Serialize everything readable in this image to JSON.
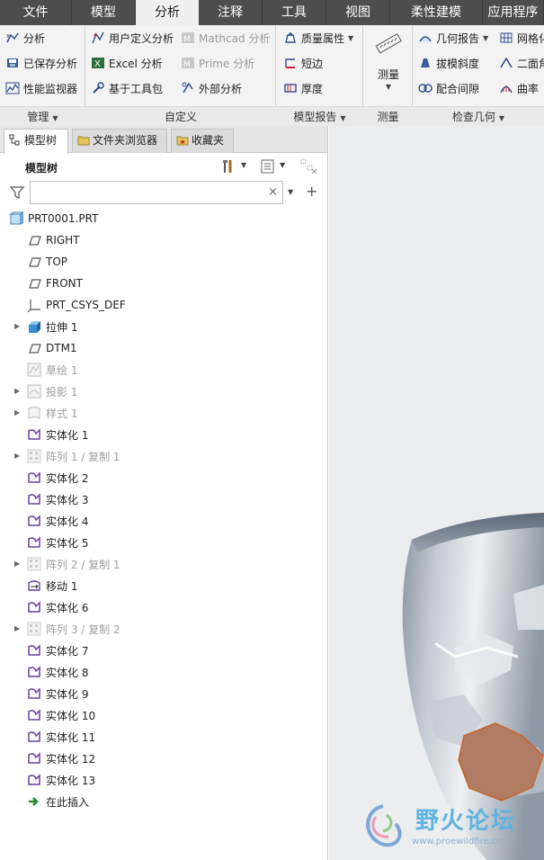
{
  "menu": {
    "tabs": [
      {
        "label": "文件"
      },
      {
        "label": "模型"
      },
      {
        "label": "分析"
      },
      {
        "label": "注释"
      },
      {
        "label": "工具"
      },
      {
        "label": "视图"
      },
      {
        "label": "柔性建模"
      },
      {
        "label": "应用程序"
      }
    ],
    "active_index": 2
  },
  "ribbon": {
    "manage": {
      "items": [
        "分析",
        "已保存分析",
        "性能监视器"
      ],
      "label": "管理"
    },
    "custom": {
      "items": [
        "用户定义分析",
        "Excel 分析",
        "基于工具包",
        "Mathcad 分析",
        "Prime 分析",
        "外部分析"
      ],
      "label": "自定义"
    },
    "model_report": {
      "items": [
        "质量属性",
        "短边",
        "厚度"
      ],
      "label": "模型报告"
    },
    "measure": {
      "items": [
        "测量"
      ],
      "label": "测量"
    },
    "inspect": {
      "items": [
        "几何报告",
        "拔模斜度",
        "配合间隙",
        "网格化",
        "二面角",
        "曲率"
      ],
      "label": "检查几何"
    }
  },
  "panel": {
    "tabs": [
      "模型树",
      "文件夹浏览器",
      "收藏夹"
    ],
    "title": "模型树",
    "search_placeholder": ""
  },
  "tree": [
    {
      "label": "PRT0001.PRT",
      "icon": "part-icon",
      "grey": false,
      "expand": false,
      "indent": 0
    },
    {
      "label": "RIGHT",
      "icon": "datum-plane-icon",
      "grey": false,
      "expand": false,
      "indent": 1
    },
    {
      "label": "TOP",
      "icon": "datum-plane-icon",
      "grey": false,
      "expand": false,
      "indent": 1
    },
    {
      "label": "FRONT",
      "icon": "datum-plane-icon",
      "grey": false,
      "expand": false,
      "indent": 1
    },
    {
      "label": "PRT_CSYS_DEF",
      "icon": "csys-icon",
      "grey": false,
      "expand": false,
      "indent": 1
    },
    {
      "label": "拉伸 1",
      "icon": "extrude-icon",
      "grey": false,
      "expand": true,
      "indent": 1
    },
    {
      "label": "DTM1",
      "icon": "datum-plane-icon",
      "grey": false,
      "expand": false,
      "indent": 1
    },
    {
      "label": "草绘 1",
      "icon": "sketch-icon",
      "grey": true,
      "expand": false,
      "indent": 1
    },
    {
      "label": "投影 1",
      "icon": "project-icon",
      "grey": true,
      "expand": true,
      "indent": 1
    },
    {
      "label": "样式 1",
      "icon": "style-icon",
      "grey": true,
      "expand": true,
      "indent": 1
    },
    {
      "label": "实体化 1",
      "icon": "solidify-icon",
      "grey": false,
      "expand": false,
      "indent": 1
    },
    {
      "label": "阵列 1 / 复制 1",
      "icon": "pattern-icon",
      "grey": true,
      "expand": true,
      "indent": 1
    },
    {
      "label": "实体化 2",
      "icon": "solidify-icon",
      "grey": false,
      "expand": false,
      "indent": 1
    },
    {
      "label": "实体化 3",
      "icon": "solidify-icon",
      "grey": false,
      "expand": false,
      "indent": 1
    },
    {
      "label": "实体化 4",
      "icon": "solidify-icon",
      "grey": false,
      "expand": false,
      "indent": 1
    },
    {
      "label": "实体化 5",
      "icon": "solidify-icon",
      "grey": false,
      "expand": false,
      "indent": 1
    },
    {
      "label": "阵列 2 / 复制 1",
      "icon": "pattern-icon",
      "grey": true,
      "expand": true,
      "indent": 1
    },
    {
      "label": "移动 1",
      "icon": "move-icon",
      "grey": false,
      "expand": false,
      "indent": 1
    },
    {
      "label": "实体化 6",
      "icon": "solidify-icon",
      "grey": false,
      "expand": false,
      "indent": 1
    },
    {
      "label": "阵列 3 / 复制 2",
      "icon": "pattern-icon",
      "grey": true,
      "expand": true,
      "indent": 1
    },
    {
      "label": "实体化 7",
      "icon": "solidify-icon",
      "grey": false,
      "expand": false,
      "indent": 1
    },
    {
      "label": "实体化 8",
      "icon": "solidify-icon",
      "grey": false,
      "expand": false,
      "indent": 1
    },
    {
      "label": "实体化 9",
      "icon": "solidify-icon",
      "grey": false,
      "expand": false,
      "indent": 1
    },
    {
      "label": "实体化 10",
      "icon": "solidify-icon",
      "grey": false,
      "expand": false,
      "indent": 1
    },
    {
      "label": "实体化 11",
      "icon": "solidify-icon",
      "grey": false,
      "expand": false,
      "indent": 1
    },
    {
      "label": "实体化 12",
      "icon": "solidify-icon",
      "grey": false,
      "expand": false,
      "indent": 1
    },
    {
      "label": "实体化 13",
      "icon": "solidify-icon",
      "grey": false,
      "expand": false,
      "indent": 1
    },
    {
      "label": "在此插入",
      "icon": "insert-here-icon",
      "grey": false,
      "expand": false,
      "indent": 1
    }
  ],
  "watermark": {
    "brand": "野火论坛",
    "url": "www.proewildfire.cn"
  },
  "colors": {
    "menubar": "#4d4d4d",
    "accent_purple": "#6a3fa0",
    "highlight_orange": "#c7754a"
  }
}
